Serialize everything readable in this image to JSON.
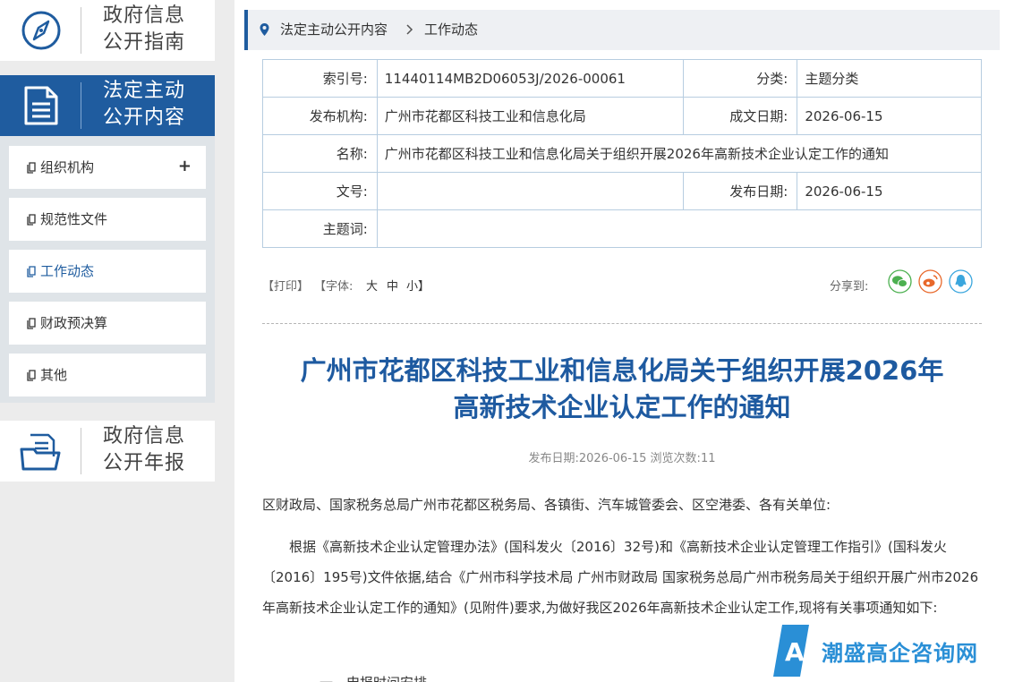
{
  "sidebar": {
    "guide": {
      "line1": "政府信息",
      "line2": "公开指南",
      "icon": "compass-icon"
    },
    "statutory": {
      "line1": "法定主动",
      "line2": "公开内容",
      "icon": "document-icon"
    },
    "annual": {
      "line1": "政府信息",
      "line2": "公开年报",
      "icon": "folder-icon"
    },
    "items": [
      {
        "label": "组织机构",
        "expand": "+"
      },
      {
        "label": "规范性文件"
      },
      {
        "label": "工作动态"
      },
      {
        "label": "财政预决算"
      },
      {
        "label": "其他"
      }
    ]
  },
  "breadcrumb": {
    "part1": "法定主动公开内容",
    "part2": "工作动态"
  },
  "meta": {
    "index_label": "索引号:",
    "index_value": "11440114MB2D06053J/2026-00061",
    "category_label": "分类:",
    "category_value": "主题分类",
    "publisher_label": "发布机构:",
    "publisher_value": "广州市花都区科技工业和信息化局",
    "created_label": "成文日期:",
    "created_value": "2026-06-15",
    "name_label": "名称:",
    "name_value": "广州市花都区科技工业和信息化局关于组织开展2026年高新技术企业认定工作的通知",
    "docno_label": "文号:",
    "docno_value": "",
    "pubdate_label": "发布日期:",
    "pubdate_value": "2026-06-15",
    "keywords_label": "主题词:",
    "keywords_value": ""
  },
  "toolbar": {
    "print": "【打印】",
    "font_label": "【字体:",
    "font_large": "大",
    "font_medium": "中",
    "font_small": "小】",
    "share_label": "分享到:",
    "colors": {
      "wechat": "#4cb050",
      "weibo": "#e8682a",
      "qq": "#3aa6dd"
    }
  },
  "article": {
    "title_line1": "广州市花都区科技工业和信息化局关于组织开展2026年",
    "title_line2": "高新技术企业认定工作的通知",
    "pub_info": "发布日期:2026-06-15  浏览次数:11",
    "p1": "区财政局、国家税务总局广州市花都区税务局、各镇街、汽车城管委会、区空港委、各有关单位:",
    "p2": "根据《高新技术企业认定管理办法》(国科发火〔2016〕32号)和《高新技术企业认定管理工作指引》(国科发火〔2016〕195号)文件依据,结合《广州市科学技术局 广州市财政局 国家税务总局广州市税务局关于组织开展广州市2026年高新技术企业认定工作的通知》(见附件)要求,为做好我区2026年高新技术企业认定工作,现将有关事项通知如下:",
    "p3": "一、申报时间安排"
  },
  "watermark": {
    "text": "潮盛高企咨询网",
    "color": "#2a8fd6"
  }
}
